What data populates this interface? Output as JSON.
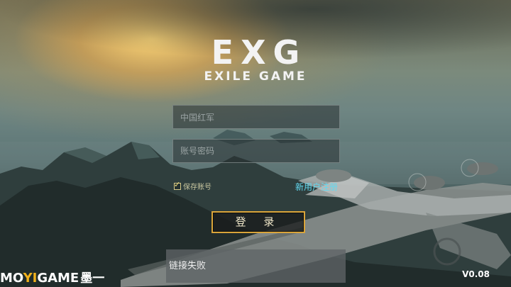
{
  "logo": {
    "main": "EXG",
    "sub": "EXILE GAME"
  },
  "login_form": {
    "username_value": "中国红军",
    "password_placeholder": "账号密码",
    "remember_label": "保存账号",
    "remember_checked": true,
    "register_link": "新用户注册",
    "login_button": "登 录"
  },
  "status_message": "链接失败",
  "watermark": {
    "mo": "MO",
    "yi": "YI",
    "game": "GAME",
    "cn": "墨一"
  },
  "version": "V0.08",
  "colors": {
    "register_link": "#62d9f0",
    "login_border": "#d9a43a",
    "brand_yi": "#f2b21b"
  }
}
